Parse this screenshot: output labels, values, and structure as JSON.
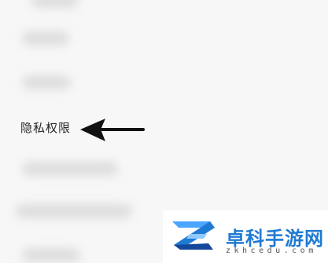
{
  "settings_list": {
    "privacy_item_label": "隐私权限",
    "arrow_icon": "left-arrow-icon"
  },
  "watermark": {
    "title": "卓科手游网",
    "domain": "zkhcedu.com",
    "logo_icon": "z-logo-icon",
    "colors": {
      "title": "#1f7ad3",
      "logo_light": "#4aa6ff",
      "logo_dark": "#14489a"
    }
  }
}
